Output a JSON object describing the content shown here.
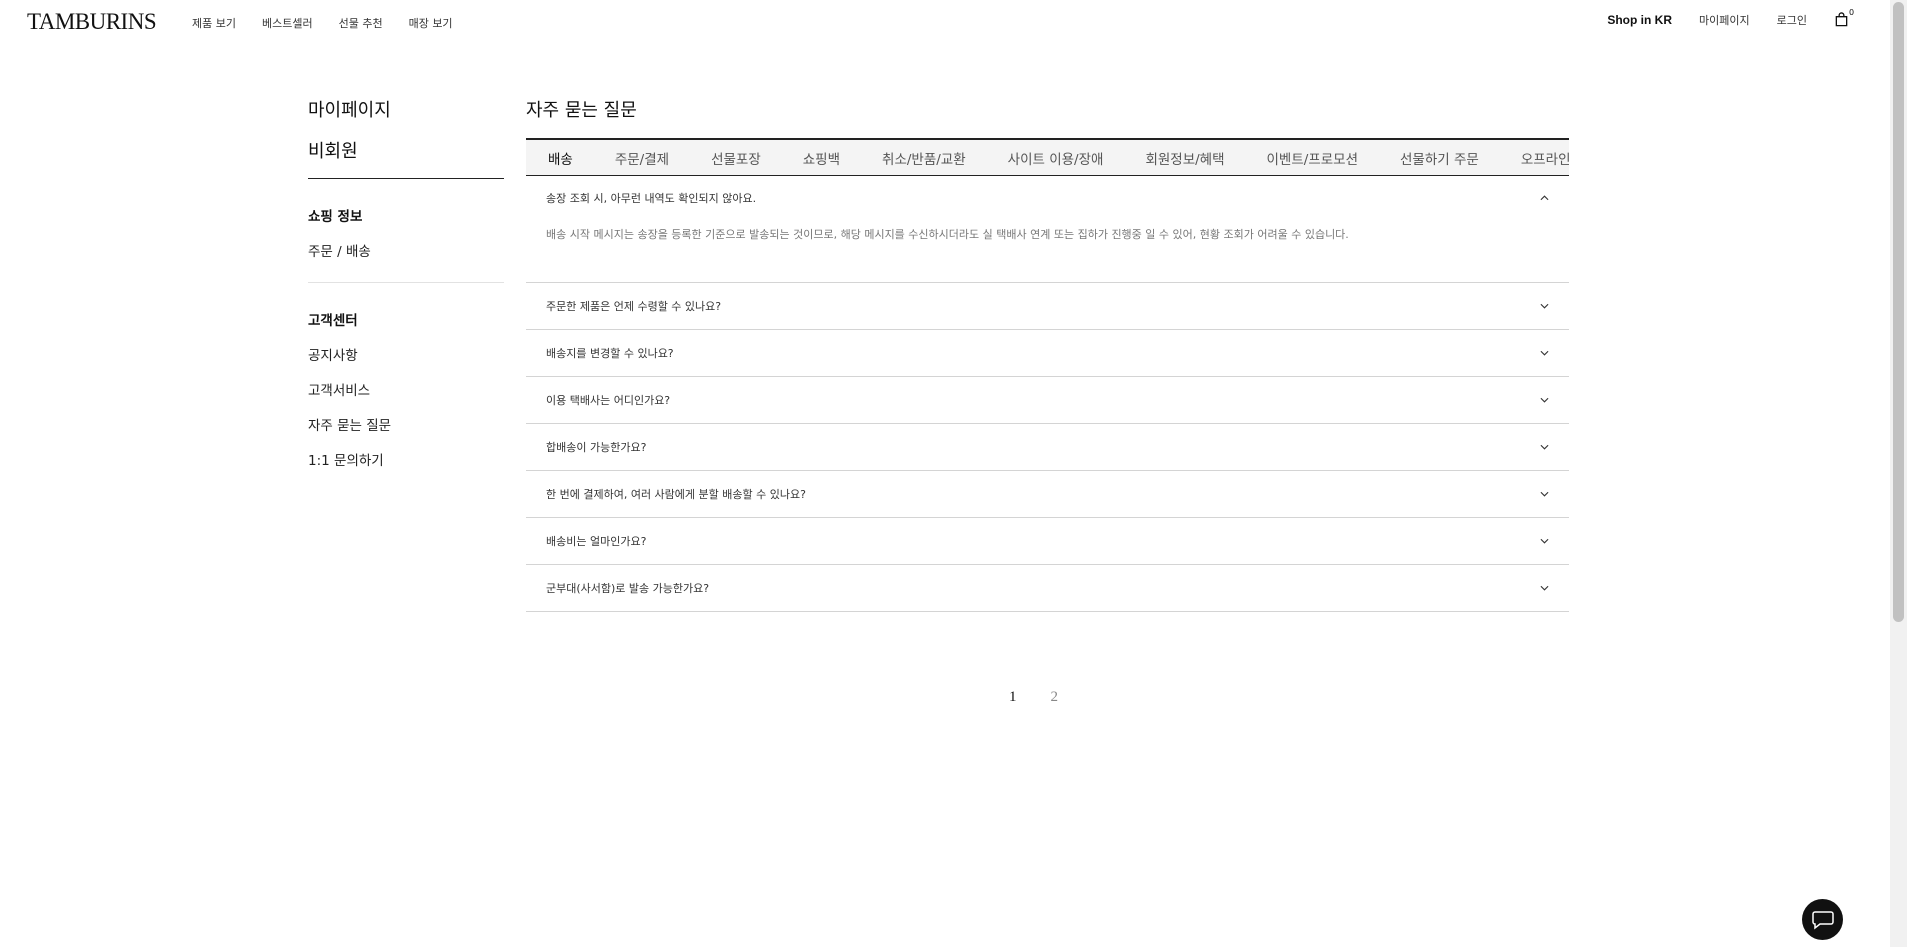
{
  "header": {
    "logo": "TAMBURINS",
    "nav": [
      "제품 보기",
      "베스트셀러",
      "선물 추천",
      "매장 보기"
    ],
    "shop_region": "Shop in KR",
    "mypage": "마이페이지",
    "login": "로그인",
    "cart_count": "0"
  },
  "sidebar": {
    "mypage_title": "마이페이지",
    "user_type": "비회원",
    "shopping_heading": "쇼핑 정보",
    "shopping_items": [
      "주문 / 배송"
    ],
    "cs_heading": "고객센터",
    "cs_items": [
      "공지사항",
      "고객서비스",
      "자주 묻는 질문",
      "1:1 문의하기"
    ]
  },
  "main": {
    "title": "자주 묻는 질문",
    "tabs": [
      "배송",
      "주문/결제",
      "선물포장",
      "쇼핑백",
      "취소/반품/교환",
      "사이트 이용/장애",
      "회원정보/혜택",
      "이벤트/프로모션",
      "선물하기 주문",
      "오프라인"
    ],
    "active_tab": "배송",
    "faqs": [
      {
        "question": "송장 조회 시, 아무런 내역도 확인되지 않아요.",
        "answer": "배송 시작 메시지는 송장을 등록한 기준으로 발송되는 것이므로, 해당 메시지를 수신하시더라도 실 택배사 연계 또는 집하가 진행중 일 수 있어, 현황 조회가 어려울 수 있습니다."
      },
      {
        "question": "주문한 제품은 언제 수령할 수 있나요?"
      },
      {
        "question": "배송지를 변경할 수 있나요?"
      },
      {
        "question": "이용 택배사는 어디인가요?"
      },
      {
        "question": "합배송이 가능한가요?"
      },
      {
        "question": "한 번에 결제하여, 여러 사람에게 분할 배송할 수 있나요?"
      },
      {
        "question": "배송비는 얼마인가요?"
      },
      {
        "question": "군부대(사서함)로 발송 가능한가요?"
      }
    ],
    "pagination": [
      "1",
      "2"
    ],
    "current_page": "1"
  },
  "icons": {
    "cart": "shopping-bag-icon",
    "chevron_up": "chevron-up-icon",
    "chevron_down": "chevron-down-icon",
    "chat": "chat-bubble-icon"
  }
}
